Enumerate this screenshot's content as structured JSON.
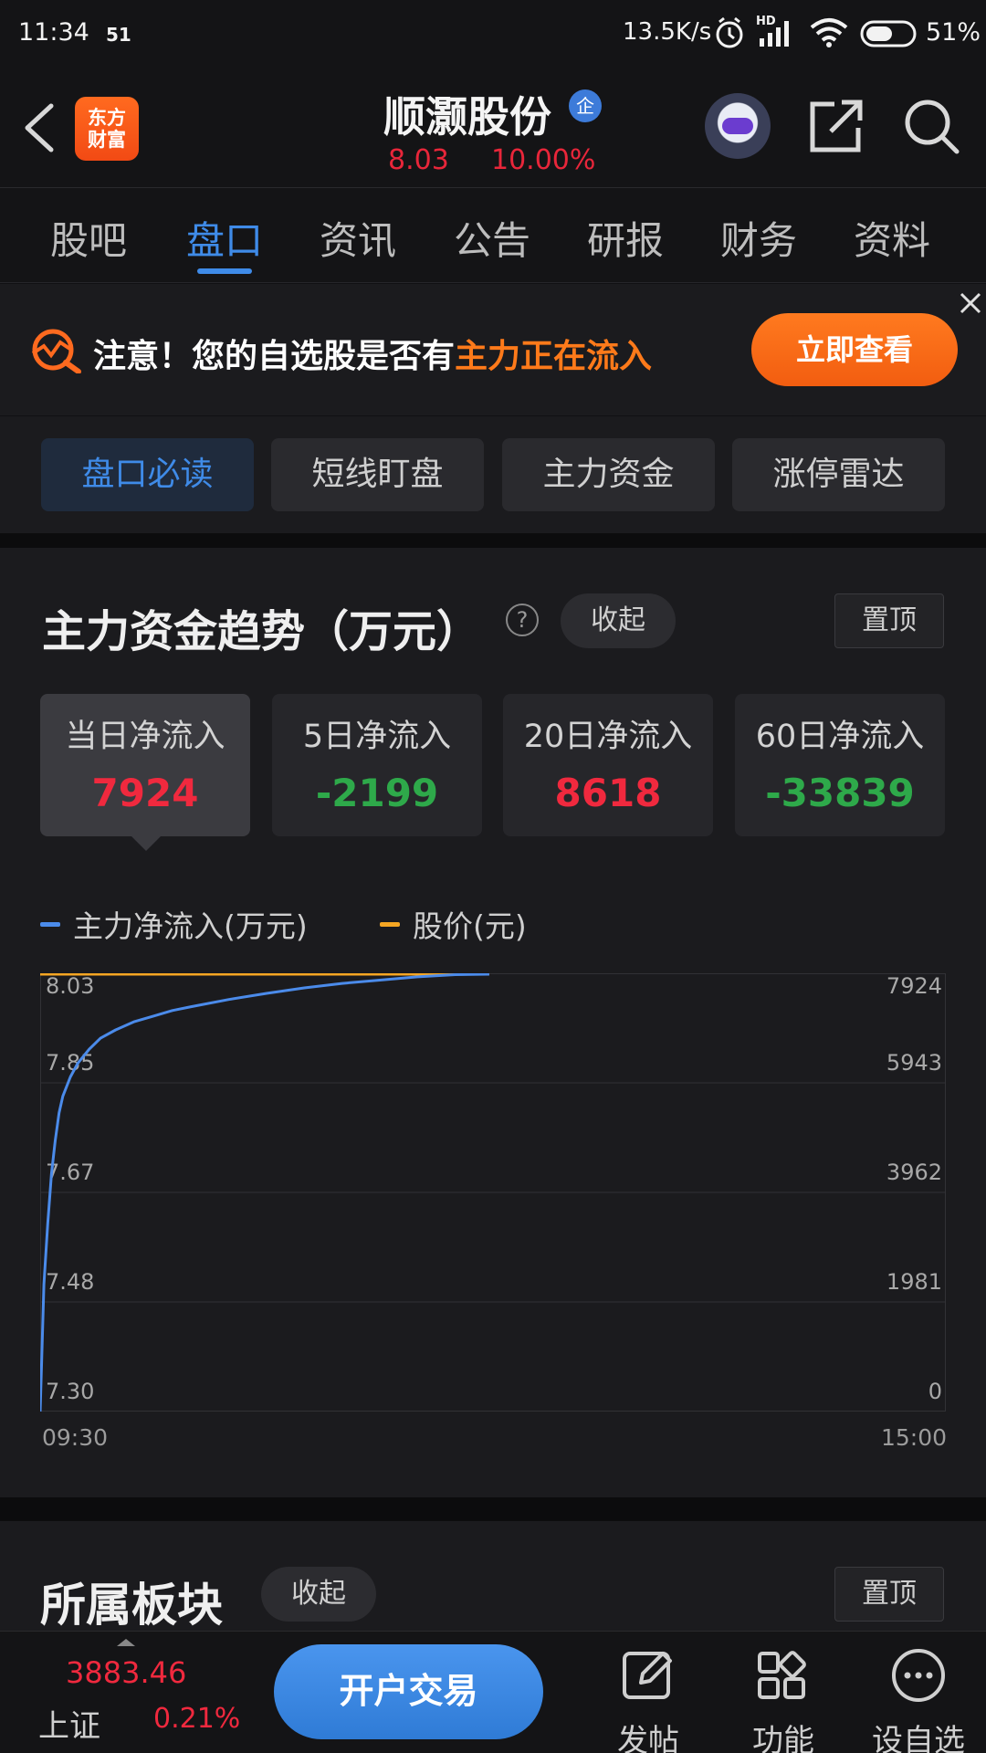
{
  "status_bar": {
    "time": "11:34",
    "notif": "51",
    "net_speed": "13.5K/s",
    "hd": "HD",
    "battery": "51%"
  },
  "header": {
    "logo_line1": "东方",
    "logo_line2": "财富",
    "stock_name": "顺灏股份",
    "badge": "企",
    "price": "8.03",
    "change_pct": "10.00%"
  },
  "tabs": [
    "股吧",
    "盘口",
    "资讯",
    "公告",
    "研报",
    "财务",
    "资料"
  ],
  "promo": {
    "text_prefix": "注意！您的自选股是否有",
    "text_highlight": "主力正在流入",
    "button": "立即查看"
  },
  "subtabs": [
    "盘口必读",
    "短线盯盘",
    "主力资金",
    "涨停雷达"
  ],
  "fund_card": {
    "title": "主力资金趋势（万元）",
    "help": "?",
    "collapse": "收起",
    "pin": "置顶",
    "stats": [
      {
        "label": "当日净流入",
        "value": "7924",
        "tone": "red"
      },
      {
        "label": "5日净流入",
        "value": "-2199",
        "tone": "green"
      },
      {
        "label": "20日净流入",
        "value": "8618",
        "tone": "red"
      },
      {
        "label": "60日净流入",
        "value": "-33839",
        "tone": "green"
      }
    ],
    "legend_flow": "主力净流入(万元)",
    "legend_price": "股价(元)"
  },
  "chart_data": {
    "type": "line",
    "x_start": "09:30",
    "x_end": "15:00",
    "left_ticks": [
      "8.03",
      "7.85",
      "7.67",
      "7.48",
      "7.30"
    ],
    "right_ticks": [
      "7924",
      "5943",
      "3962",
      "1981",
      "0"
    ],
    "y_left_range": [
      7.3,
      8.03
    ],
    "y_right_range": [
      0,
      7924
    ],
    "x_range_minutes": [
      0,
      240
    ],
    "series": [
      {
        "name": "股价(元)",
        "color": "#f5a623",
        "axis": "left",
        "x": [
          0,
          119
        ],
        "values": [
          8.03,
          8.03
        ]
      },
      {
        "name": "主力净流入(万元)",
        "color": "#4b8bea",
        "axis": "right",
        "x": [
          0,
          1,
          2,
          3,
          4,
          5,
          6,
          8,
          10,
          13,
          16,
          20,
          25,
          30,
          35,
          40,
          50,
          60,
          70,
          80,
          90,
          100,
          110,
          119
        ],
        "values": [
          0,
          2300,
          3400,
          4300,
          4900,
          5400,
          5700,
          6050,
          6300,
          6550,
          6750,
          6900,
          7050,
          7150,
          7250,
          7320,
          7450,
          7560,
          7660,
          7740,
          7800,
          7860,
          7900,
          7924
        ]
      }
    ]
  },
  "sector": {
    "title": "所属板块",
    "collapse": "收起",
    "pin": "置顶"
  },
  "bottom_bar": {
    "index_value": "3883.46",
    "index_name": "上证",
    "index_pct": "0.21%",
    "trade_button": "开户交易",
    "post": "发帖",
    "functions": "功能",
    "watchlist": "设自选"
  }
}
